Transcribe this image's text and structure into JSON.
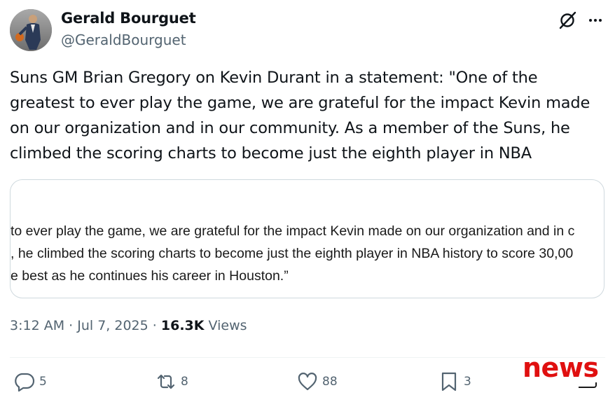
{
  "author": {
    "display_name": "Gerald Bourguet",
    "handle": "@GeraldBourguet"
  },
  "tweet": {
    "text": "Suns GM Brian Gregory on Kevin Durant in a statement: \"One of the\ngreatest to ever play the game, we are grateful for the impact Kevin made\non our organization and in our community. As a member of the Suns, he\nclimbed the scoring charts to become just the eighth player in NBA"
  },
  "media": {
    "lines": [
      " to ever play the game, we are grateful for the impact Kevin made on our organization and in c",
      ", he climbed the scoring charts to become just the eighth player in NBA history to score 30,00",
      "e best as he continues his career in Houston.”"
    ]
  },
  "meta": {
    "time": "3:12 AM",
    "date": "Jul 7, 2025",
    "views_count": "16.3K",
    "views_label": "Views"
  },
  "actions": {
    "replies": "5",
    "reposts": "8",
    "likes": "88",
    "bookmarks": "3"
  },
  "icons": {
    "grok": "grok-icon",
    "more": "more-icon",
    "reply": "reply-icon",
    "repost": "repost-icon",
    "like": "heart-icon",
    "bookmark": "bookmark-icon"
  },
  "watermark": {
    "text": "news"
  },
  "colors": {
    "text_primary": "#0f1419",
    "text_secondary": "#536471",
    "border": "#cfd9de",
    "watermark": "#e01010"
  }
}
